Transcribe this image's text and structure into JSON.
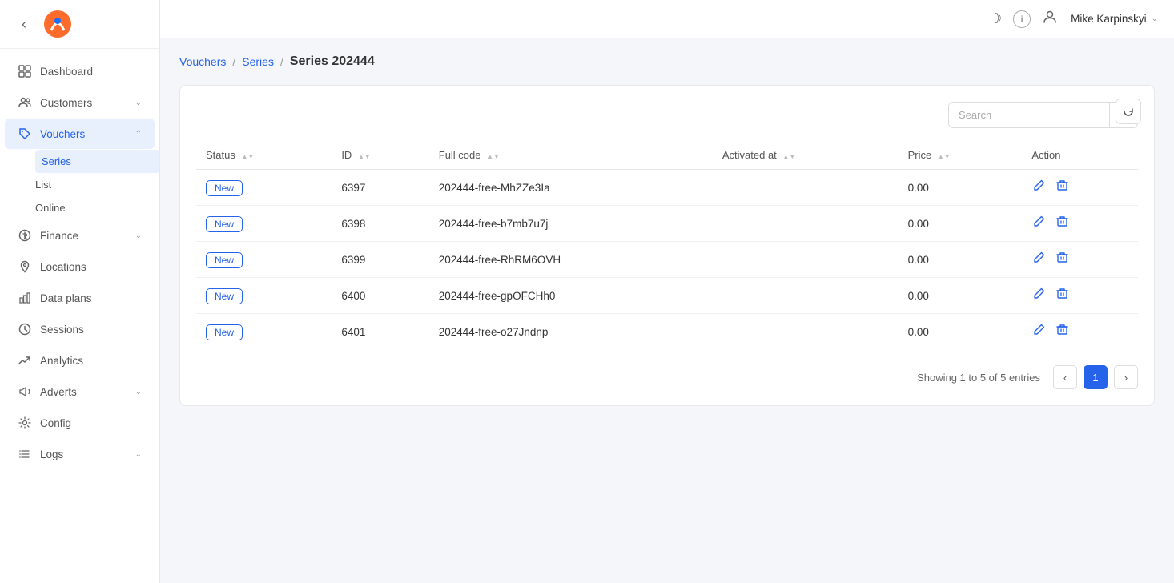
{
  "sidebar": {
    "nav_items": [
      {
        "id": "dashboard",
        "label": "Dashboard",
        "icon": "grid",
        "has_chevron": false,
        "active": false
      },
      {
        "id": "customers",
        "label": "Customers",
        "icon": "users",
        "has_chevron": true,
        "active": false
      },
      {
        "id": "vouchers",
        "label": "Vouchers",
        "icon": "tag",
        "has_chevron": true,
        "active": true,
        "sub_items": [
          {
            "id": "series",
            "label": "Series",
            "active": true
          },
          {
            "id": "list",
            "label": "List",
            "active": false
          },
          {
            "id": "online",
            "label": "Online",
            "active": false
          }
        ]
      },
      {
        "id": "finance",
        "label": "Finance",
        "icon": "dollar",
        "has_chevron": true,
        "active": false
      },
      {
        "id": "locations",
        "label": "Locations",
        "icon": "map-pin",
        "has_chevron": false,
        "active": false
      },
      {
        "id": "data-plans",
        "label": "Data plans",
        "icon": "bar-chart",
        "has_chevron": false,
        "active": false
      },
      {
        "id": "sessions",
        "label": "Sessions",
        "icon": "clock",
        "has_chevron": false,
        "active": false
      },
      {
        "id": "analytics",
        "label": "Analytics",
        "icon": "trending-up",
        "has_chevron": false,
        "active": false
      },
      {
        "id": "adverts",
        "label": "Adverts",
        "icon": "megaphone",
        "has_chevron": true,
        "active": false
      },
      {
        "id": "config",
        "label": "Config",
        "icon": "settings",
        "has_chevron": false,
        "active": false
      },
      {
        "id": "logs",
        "label": "Logs",
        "icon": "list",
        "has_chevron": true,
        "active": false
      }
    ]
  },
  "topbar": {
    "user_name": "Mike Karpinskyi",
    "moon_icon": "☽",
    "info_icon": "ⓘ",
    "user_icon": "👤"
  },
  "breadcrumb": {
    "vouchers_label": "Vouchers",
    "series_label": "Series",
    "current_label": "Series 202444"
  },
  "search": {
    "placeholder": "Search"
  },
  "table": {
    "columns": [
      {
        "id": "status",
        "label": "Status"
      },
      {
        "id": "id",
        "label": "ID"
      },
      {
        "id": "full_code",
        "label": "Full code"
      },
      {
        "id": "activated_at",
        "label": "Activated at"
      },
      {
        "id": "price",
        "label": "Price"
      },
      {
        "id": "action",
        "label": "Action"
      }
    ],
    "rows": [
      {
        "status": "New",
        "id": "6397",
        "full_code": "202444-free-MhZZe3Ia",
        "activated_at": "",
        "price": "0.00"
      },
      {
        "status": "New",
        "id": "6398",
        "full_code": "202444-free-b7mb7u7j",
        "activated_at": "",
        "price": "0.00"
      },
      {
        "status": "New",
        "id": "6399",
        "full_code": "202444-free-RhRM6OVH",
        "activated_at": "",
        "price": "0.00"
      },
      {
        "status": "New",
        "id": "6400",
        "full_code": "202444-free-gpOFCHh0",
        "activated_at": "",
        "price": "0.00"
      },
      {
        "status": "New",
        "id": "6401",
        "full_code": "202444-free-o27Jndnp",
        "activated_at": "",
        "price": "0.00"
      }
    ]
  },
  "pagination": {
    "info": "Showing 1 to 5 of 5 entries",
    "current_page": "1"
  }
}
